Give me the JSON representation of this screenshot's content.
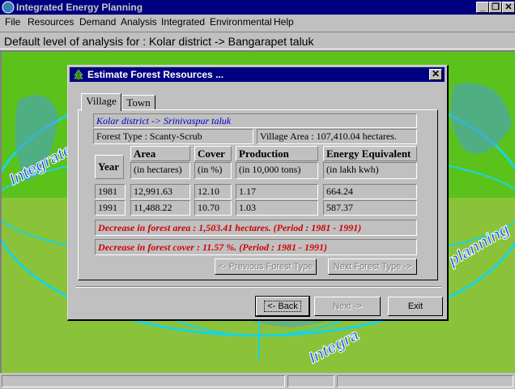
{
  "app": {
    "title": "Integrated Energy Planning"
  },
  "window_buttons": {
    "minimize": "_",
    "restore": "❐",
    "close": "✕"
  },
  "menu": [
    {
      "label": "File"
    },
    {
      "label": "Resources"
    },
    {
      "label": "Demand"
    },
    {
      "label": "Analysis"
    },
    {
      "label": "Integrated"
    },
    {
      "label": "Environmental"
    },
    {
      "label": "Help"
    }
  ],
  "analysis_level": "Default level of analysis for : Kolar district -> Bangarapet taluk",
  "background_text": [
    "Integrated",
    "planning",
    "Integra"
  ],
  "dialog": {
    "title": "Estimate Forest Resources ...",
    "close": "✕",
    "tabs": [
      {
        "label": "Village"
      },
      {
        "label": "Town"
      }
    ],
    "location": "Kolar district -> Srinivaspur taluk",
    "forest_type": "Forest Type : Scanty-Scrub",
    "village_area": "Village Area : 107,410.04 hectares.",
    "table": {
      "headers": [
        {
          "title": "Year",
          "unit": ""
        },
        {
          "title": "Area",
          "unit": "(in hectares)"
        },
        {
          "title": "Cover",
          "unit": "(in %)"
        },
        {
          "title": "Production",
          "unit": "(in 10,000 tons)"
        },
        {
          "title": "Energy Equivalent",
          "unit": "(in lakh kwh)"
        }
      ],
      "rows": [
        [
          "1981",
          "12,991.63",
          "12.10",
          "1.17",
          "664.24"
        ],
        [
          "1991",
          "11,488.22",
          "10.70",
          "1.03",
          "587.37"
        ]
      ]
    },
    "decrease_area": "Decrease in forest area : 1,503.41 hectares. (Period : 1981 - 1991)",
    "decrease_cover": "Decrease in forest cover : 11.57 %. (Period : 1981 - 1991)",
    "prev_forest_type": "<- Previous Forest Type",
    "next_forest_type": "Next Forest Type ->",
    "back": "<- Back",
    "next": "Next ->",
    "exit": "Exit"
  }
}
